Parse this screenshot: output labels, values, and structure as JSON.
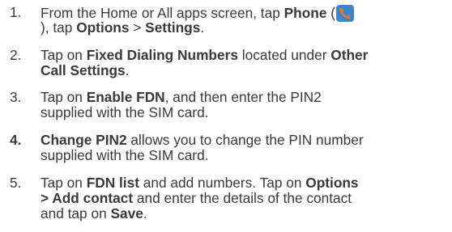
{
  "steps": [
    {
      "number": "1.",
      "number_bold": false,
      "lines": [
        [
          {
            "t": "From the Home or All apps screen, tap "
          },
          {
            "t": "Phone",
            "b": true
          },
          {
            "t": " ("
          },
          {
            "icon": "phone-icon"
          }
        ],
        [
          {
            "t": "), tap "
          },
          {
            "t": "Options",
            "b": true
          },
          {
            "t": " > "
          },
          {
            "t": "Settings",
            "b": true
          },
          {
            "t": "."
          }
        ]
      ]
    },
    {
      "number": "2.",
      "number_bold": false,
      "lines": [
        [
          {
            "t": "Tap on "
          },
          {
            "t": "Fixed Dialing Numbers",
            "b": true
          },
          {
            "t": " located under "
          },
          {
            "t": "Other",
            "b": true
          }
        ],
        [
          {
            "t": "Call Settings",
            "b": true
          },
          {
            "t": "."
          }
        ]
      ]
    },
    {
      "number": "3.",
      "number_bold": false,
      "lines": [
        [
          {
            "t": "Tap on "
          },
          {
            "t": "Enable FDN",
            "b": true
          },
          {
            "t": ", and then enter the PIN2"
          }
        ],
        [
          {
            "t": "supplied with the SIM card."
          }
        ]
      ]
    },
    {
      "number": "4.",
      "number_bold": true,
      "lines": [
        [
          {
            "t": "Change PIN2",
            "b": true
          },
          {
            "t": " allows you to change the PIN number"
          }
        ],
        [
          {
            "t": "supplied with the SIM card."
          }
        ]
      ]
    },
    {
      "number": "5.",
      "number_bold": false,
      "lines": [
        [
          {
            "t": "Tap on "
          },
          {
            "t": "FDN list",
            "b": true
          },
          {
            "t": " and add numbers. Tap on "
          },
          {
            "t": "Options",
            "b": true
          }
        ],
        [
          {
            "t": "> Add contact",
            "b": true
          },
          {
            "t": " and enter the details of the contact"
          }
        ],
        [
          {
            "t": "and tap on "
          },
          {
            "t": "Save",
            "b": true
          },
          {
            "t": "."
          }
        ]
      ]
    }
  ],
  "colors": {
    "text": "#3a3a3a",
    "phone_icon_bg": "#3b86c8",
    "phone_icon_handset": "#e8792b"
  }
}
